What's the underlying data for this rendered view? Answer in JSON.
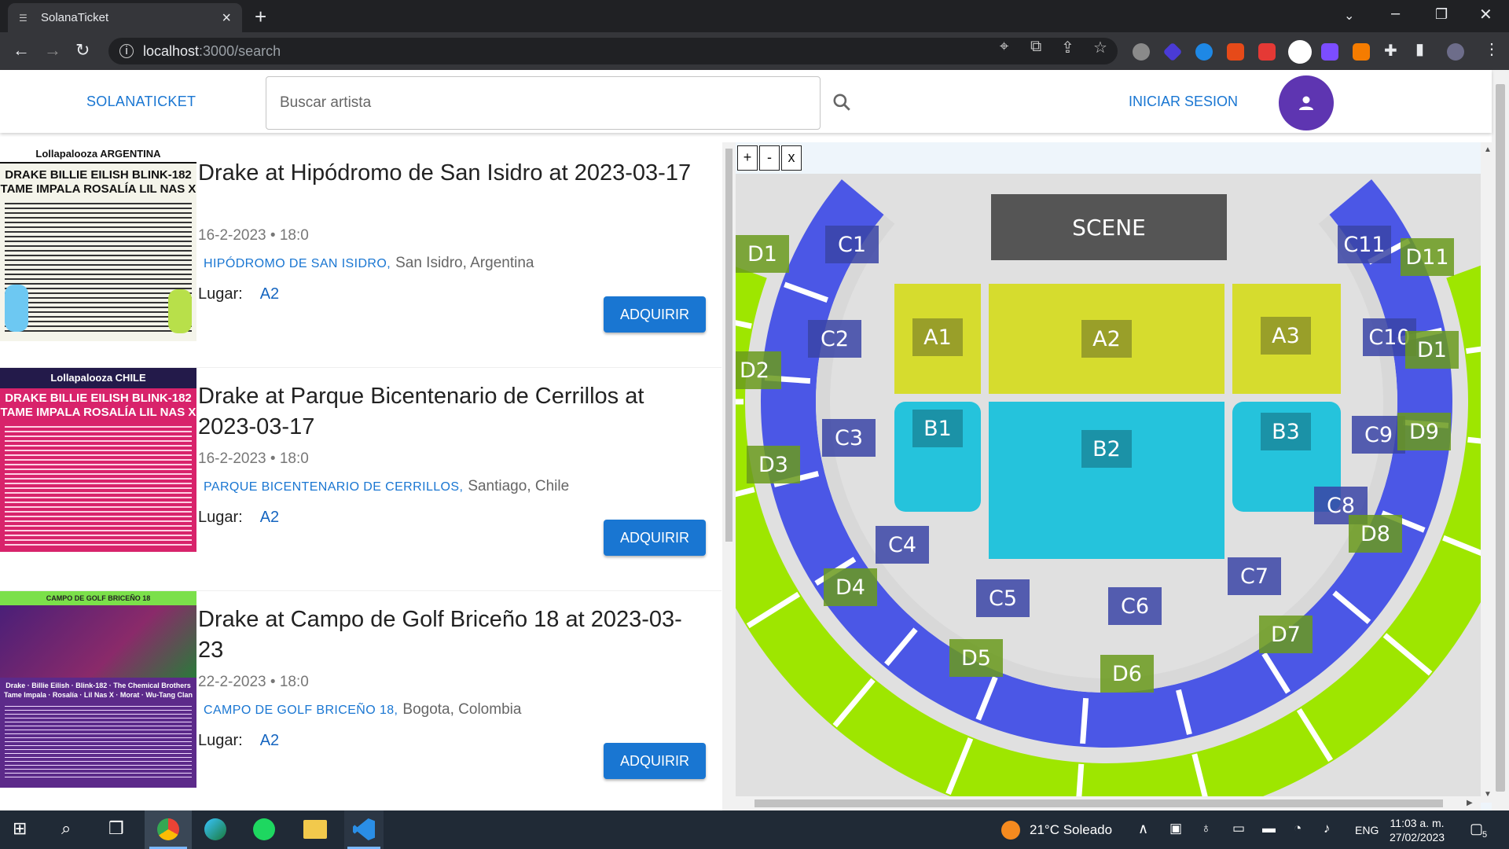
{
  "browser": {
    "tab_title": "SolanaTicket",
    "url_host": "localhost",
    "url_rest": ":3000/search"
  },
  "app": {
    "brand": "SOLANATICKET",
    "search_placeholder": "Buscar artista",
    "login_label": "INICIAR SESION",
    "accent_color": "#1976d2",
    "avatar_color": "#5e35b1"
  },
  "events": [
    {
      "title": "Drake at Hipódromo de San Isidro at 2023-03-17",
      "datetime": "16-2-2023 • 18:0",
      "venue": "HIPÓDROMO DE SAN ISIDRO,",
      "city": "San Isidro, Argentina",
      "lugar_label": "Lugar:",
      "section": "A2",
      "buy_label": "ADQUIRIR",
      "poster": {
        "header": "Lollapalooza ARGENTINA",
        "headliners": "DRAKE  BILLIE EILISH  BLINK-182\nTAME IMPALA  ROSALÍA  LIL NAS X"
      }
    },
    {
      "title": "Drake at Parque Bicentenario de Cerrillos at 2023-03-17",
      "datetime": "16-2-2023 • 18:0",
      "venue": "PARQUE BICENTENARIO DE CERRILLOS,",
      "city": "Santiago, Chile",
      "lugar_label": "Lugar:",
      "section": "A2",
      "buy_label": "ADQUIRIR",
      "poster": {
        "header": "Lollapalooza CHILE",
        "headliners": "DRAKE  BILLIE EILISH  BLINK-182\nTAME IMPALA  ROSALÍA  LIL NAS X"
      }
    },
    {
      "title": "Drake at Campo de Golf Briceño 18 at 2023-03-23",
      "datetime": "22-2-2023 • 18:0",
      "venue": "CAMPO DE GOLF BRICEÑO 18,",
      "city": "Bogota, Colombia",
      "lugar_label": "Lugar:",
      "section": "A2",
      "buy_label": "ADQUIRIR",
      "poster": {
        "header": "CAMPO DE GOLF BRICEÑO 18",
        "headliners": "Drake · Billie Eilish · Blink-182 · The Chemical Brothers\nTame Impala · Rosalía · Lil Nas X · Morat · Wu-Tang Clan"
      }
    }
  ],
  "map": {
    "zoom_in": "+",
    "zoom_out": "-",
    "reset": "x",
    "stage_label": "SCENE",
    "colors": {
      "A": "#d6dc2e",
      "B": "#25c3dc",
      "C": "#4b57e6",
      "D": "#9ee600",
      "label_bg_A": "#8e9428",
      "label_bg_B": "#1a8a9e",
      "label_bg_C": "#3a44a6",
      "label_bg_D": "#6a9a1c",
      "stage": "#555555"
    },
    "sections_A": [
      "A1",
      "A2",
      "A3"
    ],
    "sections_B": [
      "B1",
      "B2",
      "B3"
    ],
    "sections_C": [
      "C1",
      "C2",
      "C3",
      "C4",
      "C5",
      "C6",
      "C7",
      "C8",
      "C9",
      "C10",
      "C11"
    ],
    "sections_D": [
      "D1",
      "D2",
      "D3",
      "D4",
      "D5",
      "D6",
      "D7",
      "D8",
      "D9",
      "D1",
      "D11"
    ]
  },
  "taskbar": {
    "weather": "21°C Soleado",
    "lang": "ENG",
    "time": "11:03 a. m.",
    "date": "27/02/2023",
    "notifications": "5"
  }
}
